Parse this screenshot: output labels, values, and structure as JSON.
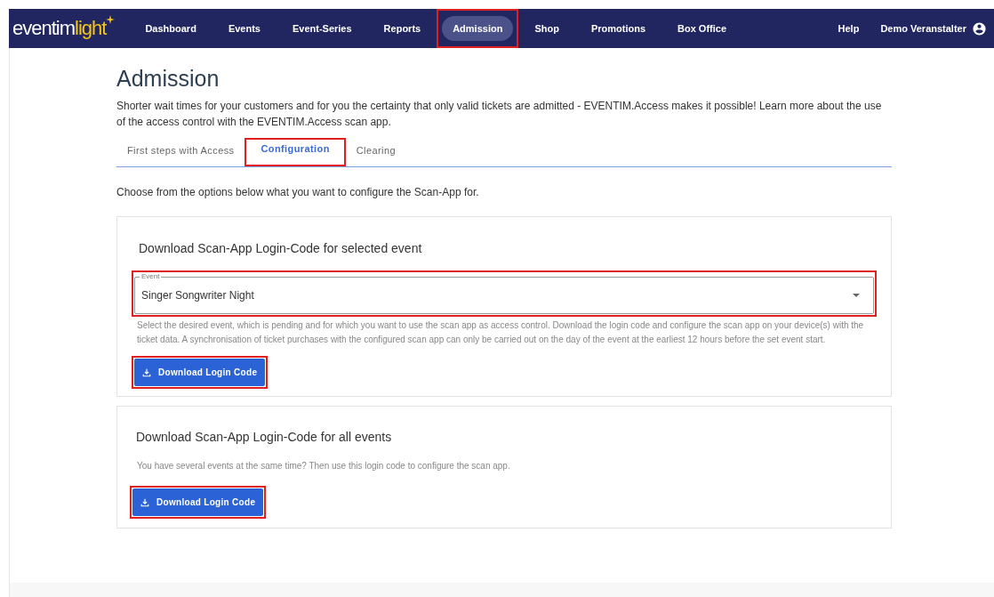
{
  "navbar": {
    "logo": {
      "main": "eventim",
      "accent": "light"
    },
    "items": [
      {
        "label": "Dashboard",
        "selected": false,
        "highlighted": false
      },
      {
        "label": "Events",
        "selected": false,
        "highlighted": false
      },
      {
        "label": "Event-Series",
        "selected": false,
        "highlighted": false
      },
      {
        "label": "Reports",
        "selected": false,
        "highlighted": false
      },
      {
        "label": "Admission",
        "selected": true,
        "highlighted": true
      },
      {
        "label": "Shop",
        "selected": false,
        "highlighted": false
      },
      {
        "label": "Promotions",
        "selected": false,
        "highlighted": false
      },
      {
        "label": "Box Office",
        "selected": false,
        "highlighted": false
      }
    ],
    "help": "Help",
    "user": "Demo Veranstalter"
  },
  "page": {
    "title": "Admission",
    "intro": "Shorter wait times for your customers and for you the certainty that only valid tickets are admitted - EVENTIM.Access makes it possible! Learn more about the use of the access control with the EVENTIM.Access scan app.",
    "tabs": [
      {
        "label": "First steps with Access",
        "selected": false,
        "highlighted": false
      },
      {
        "label": "Configuration",
        "selected": true,
        "highlighted": true
      },
      {
        "label": "Clearing",
        "selected": false,
        "highlighted": false
      }
    ],
    "instruction": "Choose from the options below what you want to configure the Scan-App for."
  },
  "cards": [
    {
      "title": "Download Scan-App Login-Code for selected event",
      "select": {
        "label": "Event",
        "value": "Singer Songwriter Night",
        "highlighted": true
      },
      "hint": "Select the desired event, which is pending and for which you want to use the scan app as access control. Download the login code and configure the scan app on your device(s) with the ticket data. A synchronisation of ticket purchases with the configured scan app can only be carried out on the day of the event at the earliest 12 hours before the set event start.",
      "button": {
        "label": "Download Login Code",
        "highlighted": true
      }
    },
    {
      "title": "Download Scan-App Login-Code for all events",
      "hint": "You have several events at the same time? Then use this login code to configure the scan app.",
      "button": {
        "label": "Download Login Code",
        "highlighted": true
      }
    }
  ]
}
